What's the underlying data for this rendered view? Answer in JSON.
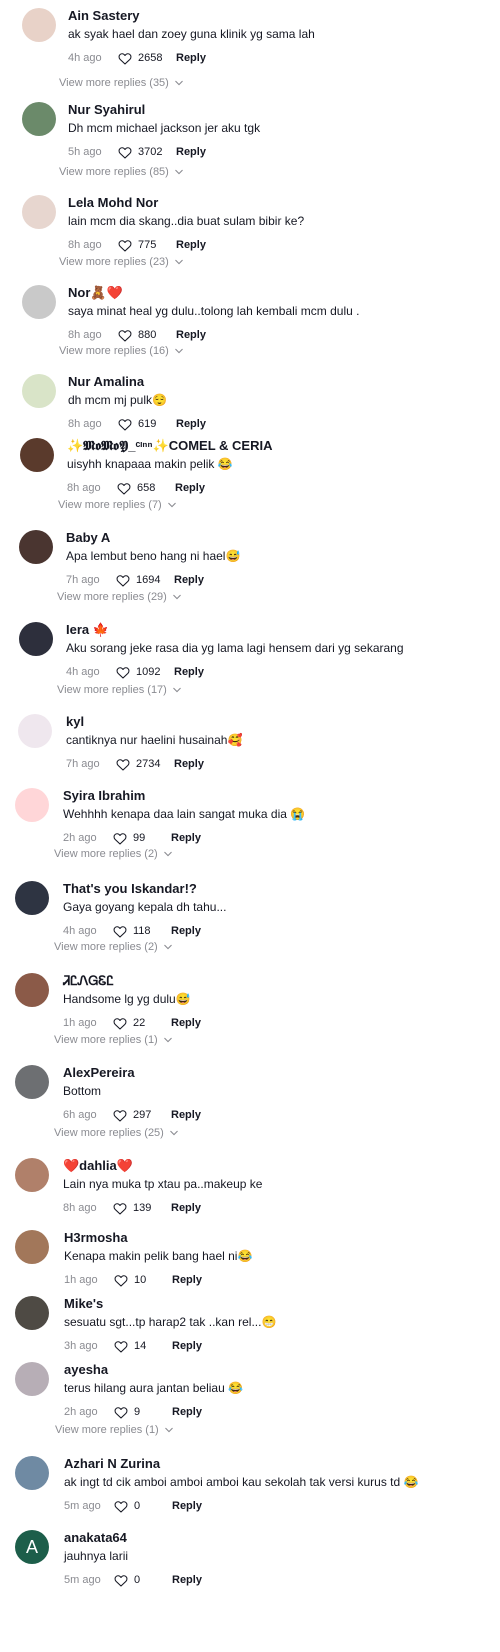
{
  "comments": [
    {
      "name": "Ain Sastery",
      "text": "ak syak hael dan zoey guna klinik yg sama lah",
      "time": "4h ago",
      "likes": "2658",
      "reply_label": "Reply",
      "more_replies": "View more replies (35)",
      "avatar_color": "#e8d2c8"
    },
    {
      "name": "Nur Syahirul",
      "text": "Dh mcm michael jackson jer aku tgk",
      "time": "5h ago",
      "likes": "3702",
      "reply_label": "Reply",
      "more_replies": "View more replies (85)",
      "avatar_color": "#6b8a6a"
    },
    {
      "name": "Lela Mohd Nor",
      "text": "lain mcm dia skang..dia buat sulam bibir ke?",
      "time": "8h ago",
      "likes": "775",
      "reply_label": "Reply",
      "more_replies": "View more replies (23)",
      "avatar_color": "#e7d6cf"
    },
    {
      "name": "Nor🧸❤️",
      "text": "saya minat heal yg dulu..tolong lah kembali mcm dulu .",
      "time": "8h ago",
      "likes": "880",
      "reply_label": "Reply",
      "more_replies": "View more replies (16)",
      "avatar_color": "#c9c9c9"
    },
    {
      "name": "Nur Amalina",
      "text": "dh mcm mj pulk😌",
      "time": "8h ago",
      "likes": "619",
      "reply_label": "Reply",
      "more_replies": "",
      "avatar_color": "#d9e4c8"
    },
    {
      "name": "✨𝕸𝖔𝕸𝖔𝖄_ᶜᶦⁿⁿ✨COMEL & CERIA",
      "text": "uisyhh knapaaa makin pelik 😂",
      "time": "8h ago",
      "likes": "658",
      "reply_label": "Reply",
      "more_replies": "View more replies (7)",
      "avatar_color": "#5a3a2c"
    },
    {
      "name": "Baby A",
      "text": "Apa lembut beno hang ni hael😅",
      "time": "7h ago",
      "likes": "1694",
      "reply_label": "Reply",
      "more_replies": "View more replies (29)",
      "avatar_color": "#4a3530"
    },
    {
      "name": "Iera 🍁",
      "text": "Aku sorang jeke rasa dia yg lama lagi hensem dari yg sekarang",
      "time": "4h ago",
      "likes": "1092",
      "reply_label": "Reply",
      "more_replies": "View more replies (17)",
      "avatar_color": "#2d2f3c"
    },
    {
      "name": "kyl",
      "text": "cantiknya nur haelini husainah🥰",
      "time": "7h ago",
      "likes": "2734",
      "reply_label": "Reply",
      "more_replies": "",
      "avatar_color": "#efe7ee"
    },
    {
      "name": "Syira Ibrahim",
      "text": "Wehhhh kenapa daa lain sangat muka dia 😭",
      "time": "2h ago",
      "likes": "99",
      "reply_label": "Reply",
      "more_replies": "View more replies (2)",
      "avatar_color": "#ffd6d8"
    },
    {
      "name": "That's you Iskandar!?",
      "text": "Gaya goyang kepala dh tahu...",
      "time": "4h ago",
      "likes": "118",
      "reply_label": "Reply",
      "more_replies": "View more replies (2)",
      "avatar_color": "#2e3442"
    },
    {
      "name": "ᏘᏝᏁᏀᏋᏝ",
      "text": "Handsome lg yg dulu😅",
      "time": "1h ago",
      "likes": "22",
      "reply_label": "Reply",
      "more_replies": "View more replies (1)",
      "avatar_color": "#8b5a48"
    },
    {
      "name": "AlexPereira",
      "text": "Bottom",
      "time": "6h ago",
      "likes": "297",
      "reply_label": "Reply",
      "more_replies": "View more replies (25)",
      "avatar_color": "#6d6f72"
    },
    {
      "name": "❤️dahlia❤️",
      "text": "Lain nya muka tp xtau pa..makeup ke",
      "time": "8h ago",
      "likes": "139",
      "reply_label": "Reply",
      "more_replies": "",
      "avatar_color": "#b0806a"
    },
    {
      "name": "H3rmosha",
      "text": "Kenapa makin pelik bang hael ni😂",
      "time": "1h ago",
      "likes": "10",
      "reply_label": "Reply",
      "more_replies": "",
      "avatar_color": "#a2775a"
    },
    {
      "name": "Mike's",
      "text": "sesuatu sgt...tp harap2 tak ..kan rel...😁",
      "time": "3h ago",
      "likes": "14",
      "reply_label": "Reply",
      "more_replies": "",
      "avatar_color": "#4e4a44"
    },
    {
      "name": "ayesha",
      "text": "terus hilang aura jantan beliau 😂",
      "time": "2h ago",
      "likes": "9",
      "reply_label": "Reply",
      "more_replies": "View more replies (1)",
      "avatar_color": "#b7aeb6"
    },
    {
      "name": "Azhari N Zurina",
      "text": "ak ingt td cik amboi amboi amboi kau sekolah tak versi kurus td 😂",
      "time": "5m ago",
      "likes": "0",
      "reply_label": "Reply",
      "more_replies": "",
      "avatar_color": "#6f8aa3"
    },
    {
      "name": "anakata64",
      "text": "jauhnya larii",
      "time": "5m ago",
      "likes": "0",
      "reply_label": "Reply",
      "more_replies": "",
      "avatar_color": "#1d5e4a",
      "avatar_letter": "A"
    }
  ]
}
